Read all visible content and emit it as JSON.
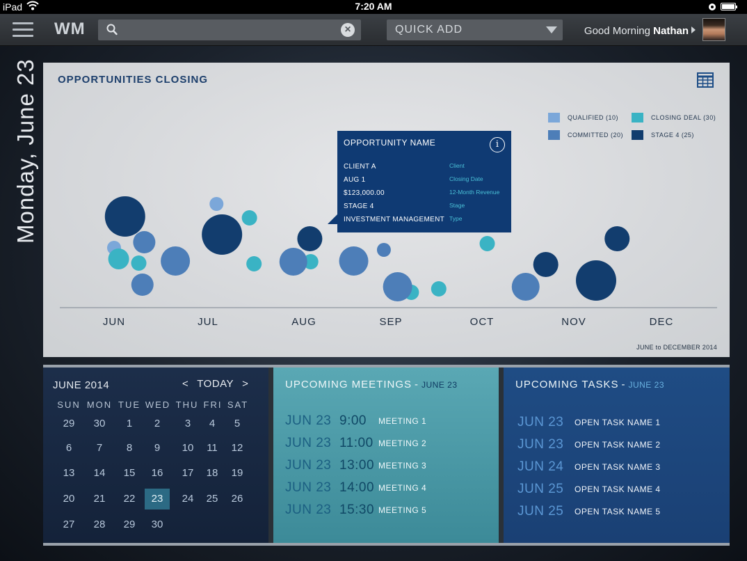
{
  "status_bar": {
    "device": "iPad",
    "time": "7:20 AM"
  },
  "nav": {
    "logo": "WM",
    "search_placeholder": "",
    "quick_add": "QUICK ADD",
    "greeting_prefix": "Good Morning",
    "user_name": "Nathan"
  },
  "date_vertical": "Monday, June 23",
  "chart": {
    "title": "OPPORTUNITIES CLOSING",
    "range": "JUNE to DECEMBER 2014",
    "legend": [
      {
        "label": "QUALIFIED (10)",
        "color": "#7ba7d9"
      },
      {
        "label": "CLOSING DEAL (30)",
        "color": "#3ab3c4"
      },
      {
        "label": "COMMITTED (20)",
        "color": "#4d7eb8"
      },
      {
        "label": "STAGE 4 (25)",
        "color": "#123d6e"
      }
    ],
    "tooltip": {
      "title": "OPPORTUNITY NAME",
      "rows": [
        {
          "value": "CLIENT A",
          "key": "Client"
        },
        {
          "value": "AUG 1",
          "key": "Closing Date"
        },
        {
          "value": "$123,000.00",
          "key": "12-Month Revenue"
        },
        {
          "value": "STAGE 4",
          "key": "Stage"
        },
        {
          "value": "INVESTMENT MANAGEMENT",
          "key": "Type"
        }
      ]
    }
  },
  "chart_data": {
    "type": "scatter",
    "title": "OPPORTUNITIES CLOSING",
    "x_ticks": [
      "JUN",
      "JUL",
      "AUG",
      "SEP",
      "OCT",
      "NOV",
      "DEC"
    ],
    "x_range": [
      "JUN",
      "DEC"
    ],
    "note": "bubble chart; x = month position, vertical position is spread only, size = deal size, color = stage",
    "series": [
      {
        "name": "QUALIFIED (10)",
        "color": "#7ba7d9",
        "points": [
          {
            "x": 0.0,
            "y": 356,
            "r": 10
          },
          {
            "x": 1.1,
            "y": 325,
            "r": 10
          },
          {
            "x": 1.12,
            "y": 293,
            "r": 10
          }
        ]
      },
      {
        "name": "CLOSING DEAL (30)",
        "color": "#3ab3c4",
        "points": [
          {
            "x": 0.05,
            "y": 372,
            "r": 15
          },
          {
            "x": 0.27,
            "y": 378,
            "r": 11
          },
          {
            "x": 1.48,
            "y": 313,
            "r": 11
          },
          {
            "x": 1.53,
            "y": 379,
            "r": 11
          },
          {
            "x": 2.15,
            "y": 376,
            "r": 11
          },
          {
            "x": 3.25,
            "y": 420,
            "r": 11
          },
          {
            "x": 3.55,
            "y": 415,
            "r": 11
          },
          {
            "x": 4.08,
            "y": 350,
            "r": 11
          }
        ]
      },
      {
        "name": "COMMITTED (20)",
        "color": "#4d7eb8",
        "points": [
          {
            "x": 0.33,
            "y": 348,
            "r": 16
          },
          {
            "x": 0.31,
            "y": 409,
            "r": 16
          },
          {
            "x": 0.67,
            "y": 375,
            "r": 21
          },
          {
            "x": 1.96,
            "y": 376,
            "r": 20
          },
          {
            "x": 2.62,
            "y": 375,
            "r": 21
          },
          {
            "x": 2.95,
            "y": 359,
            "r": 10
          },
          {
            "x": 3.1,
            "y": 412,
            "r": 21
          },
          {
            "x": 4.5,
            "y": 412,
            "r": 20
          }
        ]
      },
      {
        "name": "STAGE 4 (25)",
        "color": "#123d6e",
        "points": [
          {
            "x": 0.12,
            "y": 311,
            "r": 29
          },
          {
            "x": 1.18,
            "y": 337,
            "r": 29
          },
          {
            "x": 2.14,
            "y": 343,
            "r": 18
          },
          {
            "x": 4.72,
            "y": 380,
            "r": 18
          },
          {
            "x": 5.27,
            "y": 403,
            "r": 29
          },
          {
            "x": 5.5,
            "y": 343,
            "r": 18
          }
        ]
      }
    ]
  },
  "calendar": {
    "month": "JUNE 2014",
    "today": "TODAY",
    "prev": "<",
    "next": ">",
    "weekdays": [
      "SUN",
      "MON",
      "TUE",
      "WED",
      "THU",
      "FRI",
      "SAT"
    ],
    "weeks": [
      [
        "29",
        "30",
        "1",
        "2",
        "3",
        "4",
        "5"
      ],
      [
        "6",
        "7",
        "8",
        "9",
        "10",
        "11",
        "12"
      ],
      [
        "13",
        "14",
        "15",
        "16",
        "17",
        "18",
        "19"
      ],
      [
        "20",
        "21",
        "22",
        "23",
        "24",
        "25",
        "26"
      ],
      [
        "27",
        "28",
        "29",
        "30",
        "",
        "",
        ""
      ]
    ],
    "selected": "23"
  },
  "meetings": {
    "title": "UPCOMING MEETINGS",
    "date": "JUNE 23",
    "items": [
      {
        "date": "JUN 23",
        "time": "9:00",
        "name": "MEETING 1"
      },
      {
        "date": "JUN 23",
        "time": "11:00",
        "name": "MEETING 2"
      },
      {
        "date": "JUN 23",
        "time": "13:00",
        "name": "MEETING 3"
      },
      {
        "date": "JUN 23",
        "time": "14:00",
        "name": "MEETING 4"
      },
      {
        "date": "JUN 23",
        "time": "15:30",
        "name": "MEETING 5"
      }
    ]
  },
  "tasks": {
    "title": "UPCOMING TASKS",
    "date": "JUNE 23",
    "items": [
      {
        "date": "JUN 23",
        "name": "OPEN TASK NAME 1"
      },
      {
        "date": "JUN 23",
        "name": "OPEN TASK NAME 2"
      },
      {
        "date": "JUN 24",
        "name": "OPEN TASK NAME 3"
      },
      {
        "date": "JUN 25",
        "name": "OPEN TASK NAME 4"
      },
      {
        "date": "JUN 25",
        "name": "OPEN TASK NAME 5"
      }
    ]
  }
}
